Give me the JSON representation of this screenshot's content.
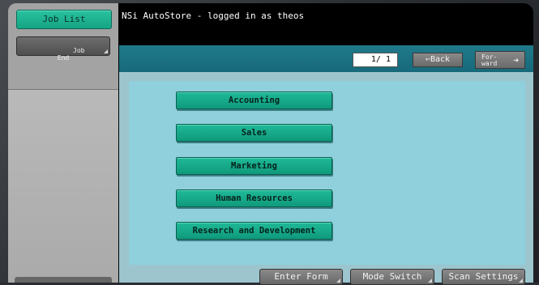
{
  "title_bar": {
    "text": "NSi AutoStore - logged in as theos"
  },
  "left_panel": {
    "job_list_label": "Job List",
    "job_end_label": "Job\nEnd"
  },
  "navigation": {
    "page_indicator": "1/ 1",
    "back_label": "Back",
    "back_arrow": "⇐",
    "forward_label": "For-\nward",
    "forward_arrow": "➜"
  },
  "forms": [
    {
      "label": "Accounting"
    },
    {
      "label": "Sales"
    },
    {
      "label": "Marketing"
    },
    {
      "label": "Human Resources"
    },
    {
      "label": "Research and Development"
    }
  ],
  "bottom_buttons": {
    "enter_form": "Enter Form",
    "mode_switch": "Mode Switch",
    "scan_settings": "Scan Settings"
  },
  "colors": {
    "accent": "#15a383",
    "header": "#1f7a8a",
    "panel": "#9cc5ce",
    "content": "#8fd0dc"
  }
}
